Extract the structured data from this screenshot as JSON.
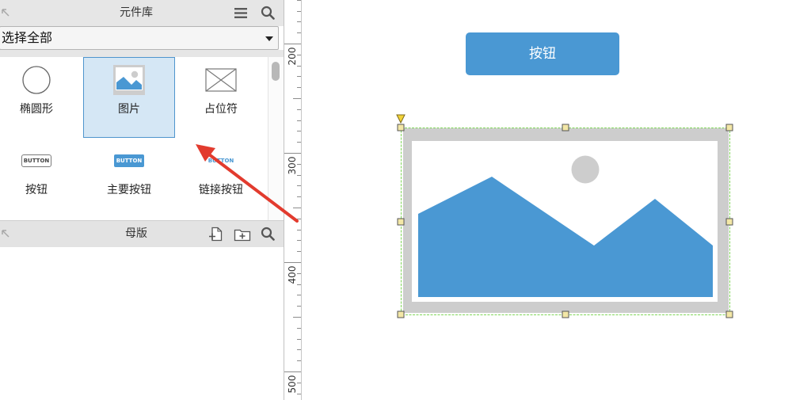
{
  "library": {
    "title": "元件库",
    "selected_library": "选择全部",
    "icons": {
      "undock": "undock-arrow-icon",
      "menu": "menu-icon",
      "search": "search-icon",
      "dropdown": "chevron-down-icon"
    },
    "widgets": [
      {
        "label": "椭圆形",
        "icon": "ellipse-icon",
        "selected": false
      },
      {
        "label": "图片",
        "icon": "image-icon",
        "selected": true
      },
      {
        "label": "占位符",
        "icon": "placeholder-icon",
        "selected": false
      },
      {
        "label": "按钮",
        "icon": "button-icon",
        "icon_text": "BUTTON",
        "selected": false
      },
      {
        "label": "主要按钮",
        "icon": "primary-button-icon",
        "icon_text": "BUTTON",
        "selected": false
      },
      {
        "label": "链接按钮",
        "icon": "link-button-icon",
        "icon_text": "BUTTON",
        "selected": false
      }
    ]
  },
  "masters": {
    "title": "母版",
    "icons": {
      "undock": "undock-arrow-icon",
      "add_master": "add-master-icon",
      "add_folder": "add-folder-icon",
      "search": "search-icon"
    }
  },
  "ruler": {
    "labels": [
      "200",
      "300",
      "400",
      "500"
    ]
  },
  "canvas": {
    "button_label": "按钮",
    "image_widget": {
      "icon": "image-placeholder-icon",
      "selected": true
    }
  },
  "annotation": {
    "icon": "red-arrow-icon"
  },
  "colors": {
    "accent": "#4a98d3",
    "selection": "#80d65a",
    "handle": "#f3e7a6",
    "annotation": "#e23b2e",
    "selected_cell": "#d5e7f5",
    "panel_header": "#e6e6e6"
  }
}
